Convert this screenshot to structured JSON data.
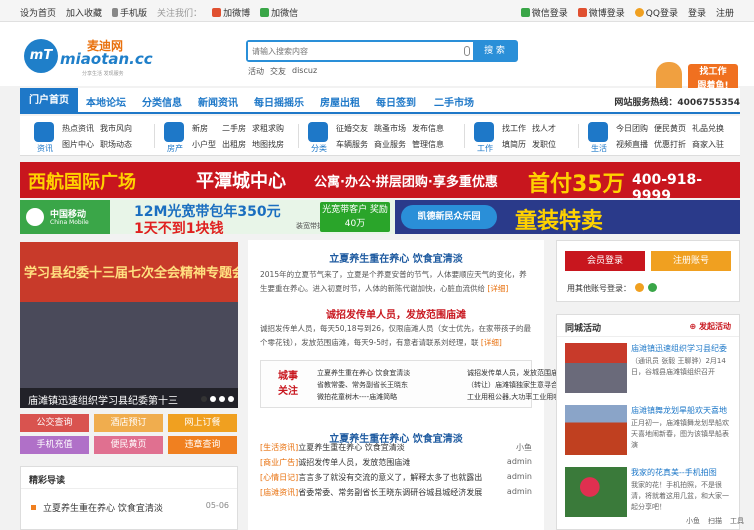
{
  "topbar": {
    "left": [
      "设为首页",
      "加入收藏",
      "手机版",
      "关注我们：",
      "加微博",
      "加微信"
    ],
    "right": [
      "微信登录",
      "微博登录",
      "QQ登录",
      "登录",
      "注册"
    ]
  },
  "logo": {
    "cn": "麦迪网",
    "en": "miaotan.cc",
    "slogan": "分享生活 发现服务"
  },
  "search": {
    "placeholder": "请输入搜索内容",
    "button": "搜 索",
    "hot": [
      "活动",
      "交友",
      "discuz"
    ]
  },
  "mascot": {
    "line1": "找工作",
    "line2": "跟着鱼!"
  },
  "nav": {
    "items": [
      "门户首页",
      "本地论坛",
      "分类信息",
      "新闻资讯",
      "每日摇摇乐",
      "房屋出租",
      "每日签到",
      "二手市场"
    ],
    "phone": "网站服务热线：4006755354"
  },
  "cats": [
    {
      "label": "资讯",
      "links": [
        "热点资讯",
        "我市风向",
        "",
        "图片中心",
        "职场动态",
        ""
      ]
    },
    {
      "label": "房产",
      "links": [
        "新房",
        "二手房",
        "求租求购",
        "小户型",
        "出租房",
        "地图找房"
      ]
    },
    {
      "label": "分类",
      "links": [
        "征婚交友",
        "跳蚤市场",
        "发布信息",
        "车辆服务",
        "商业服务",
        "管理信息"
      ]
    },
    {
      "label": "工作",
      "links": [
        "找工作",
        "找人才",
        "",
        "填简历",
        "发职位",
        ""
      ]
    },
    {
      "label": "生活",
      "links": [
        "今日团购",
        "便民黄页",
        "礼品兑换",
        "视频直播",
        "优惠打折",
        "商家入驻"
      ]
    }
  ],
  "banner1": {
    "t1": "西航国际广场",
    "t2": "平潭城中心",
    "t3": "公寓·办公·拼层团购·享多重优惠",
    "t4": "首付35万",
    "t5": "400-918-9999"
  },
  "banner2": {
    "cm_a": "中国移动",
    "cm_b": "China Mobile",
    "bd_a": "12M光宽带包年350元",
    "bd_b": "1天不到1块钱",
    "bd_c": "装宽带拨打10086",
    "bd_d": "光宽带客户 奖励40万",
    "kd_a": "凯德新民众乐园",
    "kd_b": "童装特卖"
  },
  "photo": {
    "sky_text": "学习县纪委十三届七次全会精神专题会",
    "caption": "庙滩镇迅速组织学习县纪委第十三"
  },
  "services": [
    {
      "label": "公交查询",
      "color": "#d9534f"
    },
    {
      "label": "酒店预订",
      "color": "#f0ad4e"
    },
    {
      "label": "网上订餐",
      "color": "#f0a020"
    },
    {
      "label": "手机充值",
      "color": "#b070c8"
    },
    {
      "label": "便民黄页",
      "color": "#e07090"
    },
    {
      "label": "违章查询",
      "color": "#f08020"
    }
  ],
  "guide": {
    "title": "精彩导读",
    "item": "立夏养生重在养心 饮食宜清淡",
    "date": "05-06"
  },
  "articles": [
    {
      "title": "立夏养生重在养心 饮食宜清淡",
      "body": "2015年的立夏节气来了，立夏是个养夏安普的节气，人体要顺应天气的变化，养生要重在养心。进入初夏时节，人体的新陈代谢加快，心脏血流供给",
      "more": "[详细]"
    },
    {
      "title": "诚招发传单人员，发放范围庙滩",
      "body": "诚招发传单人员，每天50,18号到26，仅限庙滩人员（女士优先，在家带孩子的最个零花钱），发放范围庙滩，每天9-5时，有意者请联系刘经理，联",
      "more": "[详细]"
    }
  ],
  "box": {
    "stamp1": "城事",
    "stamp2": "关注",
    "items": [
      "立夏养生重在养心 饮食宜清淡",
      "诚招发传单人员，发放范围庙",
      "省教常委、常务副省长王晓东",
      "（转让）庙滩镇独家生意寻合",
      "微拍花童树木----庙滩简略",
      "工业用租公器,大功率工业用吸"
    ]
  },
  "list": {
    "title": "立夏养生重在养心 饮食宜清淡",
    "rows": [
      {
        "cat": "[生活资讯]",
        "text": "立夏养生重在养心 饮食宜清淡",
        "meta": "小鱼"
      },
      {
        "cat": "[商业广告]",
        "text": "诚招发传单人员，发放范围庙滩",
        "meta": "admin"
      },
      {
        "cat": "[心情日记]",
        "text": "言言多了就没有交流的意义了，解释太多了也就露出",
        "meta": "admin"
      },
      {
        "cat": "[庙滩资讯]",
        "text": "省委常委、常务副省长王晓东调研谷城县城经济发展",
        "meta": "admin"
      }
    ]
  },
  "login": {
    "member": "会员登录",
    "register": "注册账号",
    "note": "用其他账号登录："
  },
  "activity": {
    "title": "同城活动",
    "post": "发起活动",
    "items": [
      {
        "title": "庙滩镇迅速组织学习县纪委",
        "desc": "（通讯员 张毅 王聊骅）2月14日，谷城县庙滩镇组织召开"
      },
      {
        "title": "庙滩镇舞龙划旱船欢天喜地",
        "desc": "正月初一，庙滩镇舞龙划旱船欢天喜地闹新春，图为该镇旱船表演"
      },
      {
        "title": "我家的花真美--手机拍图",
        "desc": "我家的花！手机拍照，不是很清，将就着这用几盆，和大家一起分享吧！"
      }
    ]
  },
  "bottombar": [
    "小鱼",
    "扫描",
    "工具"
  ]
}
